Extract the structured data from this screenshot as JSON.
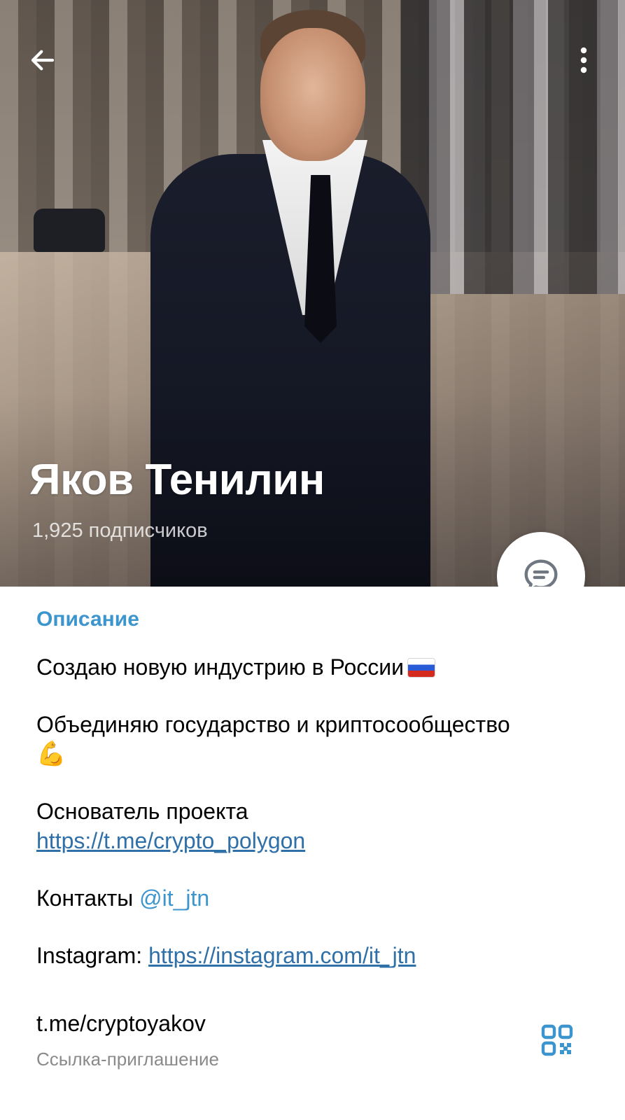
{
  "header": {
    "channel_name": "Яков Тенилин",
    "subscribers": "1,925 подписчиков"
  },
  "icons": {
    "back": "back-arrow-icon",
    "menu": "more-vertical-icon",
    "comments": "chat-bubble-icon",
    "qr": "qr-code-icon"
  },
  "colors": {
    "accent": "#3d95ce",
    "link": "#3070a8",
    "muted": "#8a8a8a"
  },
  "info": {
    "section_title": "Описание",
    "lines": {
      "industry": "Создаю новую индустрию в России",
      "unite": "Объединяю государство и криптосообщество",
      "founder": "Основатель проекта",
      "founder_link": "https://t.me/crypto_polygon",
      "contacts": "Контакты",
      "contacts_handle": "@it_jtn",
      "instagram": "Instagram:",
      "instagram_link": "https://instagram.com/it_jtn"
    },
    "invite_link": "t.me/cryptoyakov",
    "invite_caption": "Ссылка-приглашение"
  }
}
